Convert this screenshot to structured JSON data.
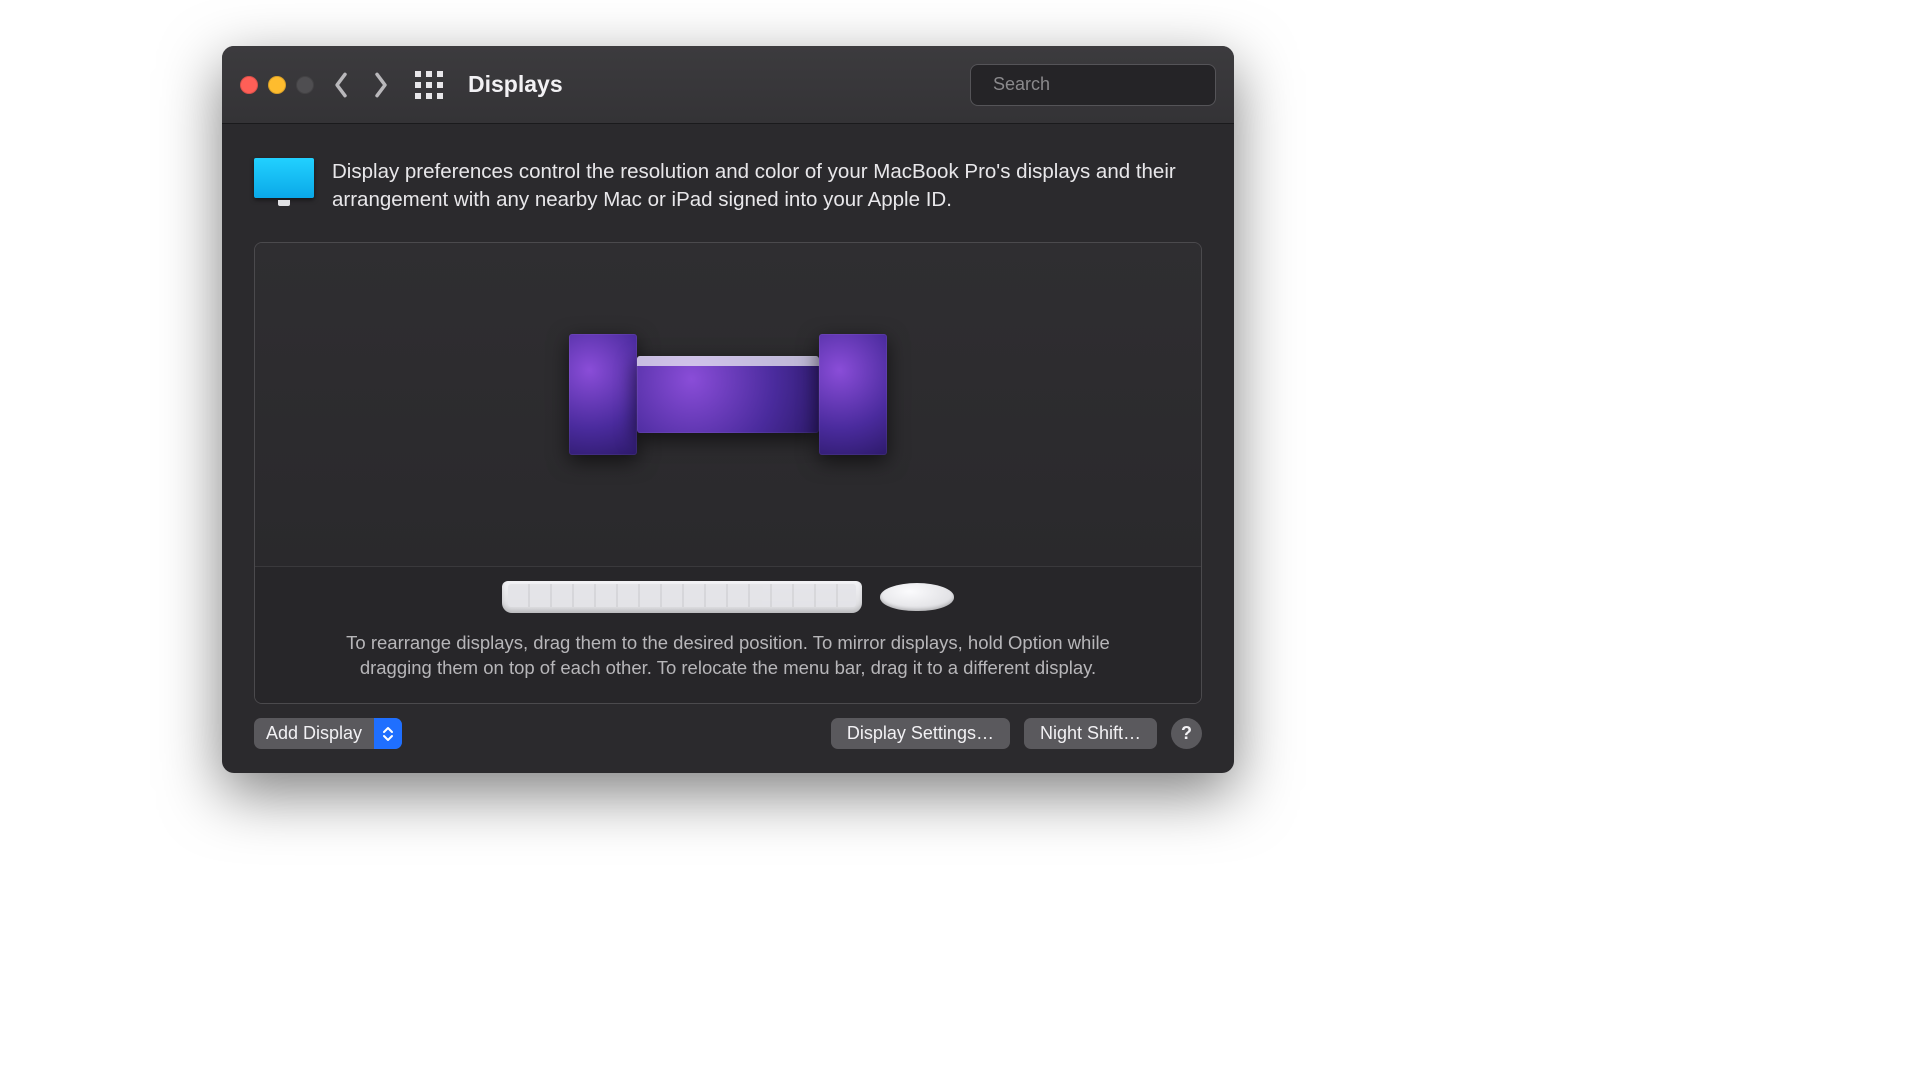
{
  "window": {
    "title": "Displays"
  },
  "search": {
    "placeholder": "Search",
    "value": ""
  },
  "intro": {
    "text": "Display preferences control the resolution and color of your MacBook Pro's displays and their arrangement with any nearby Mac or iPad signed into your Apple ID."
  },
  "arrangement": {
    "hint": "To rearrange displays, drag them to the desired position. To mirror displays, hold Option while dragging them on top of each other. To relocate the menu bar, drag it to a different display."
  },
  "buttons": {
    "add_display": "Add Display",
    "display_settings": "Display Settings…",
    "night_shift": "Night Shift…",
    "help": "?"
  },
  "colors": {
    "accent": "#1f6fff"
  }
}
